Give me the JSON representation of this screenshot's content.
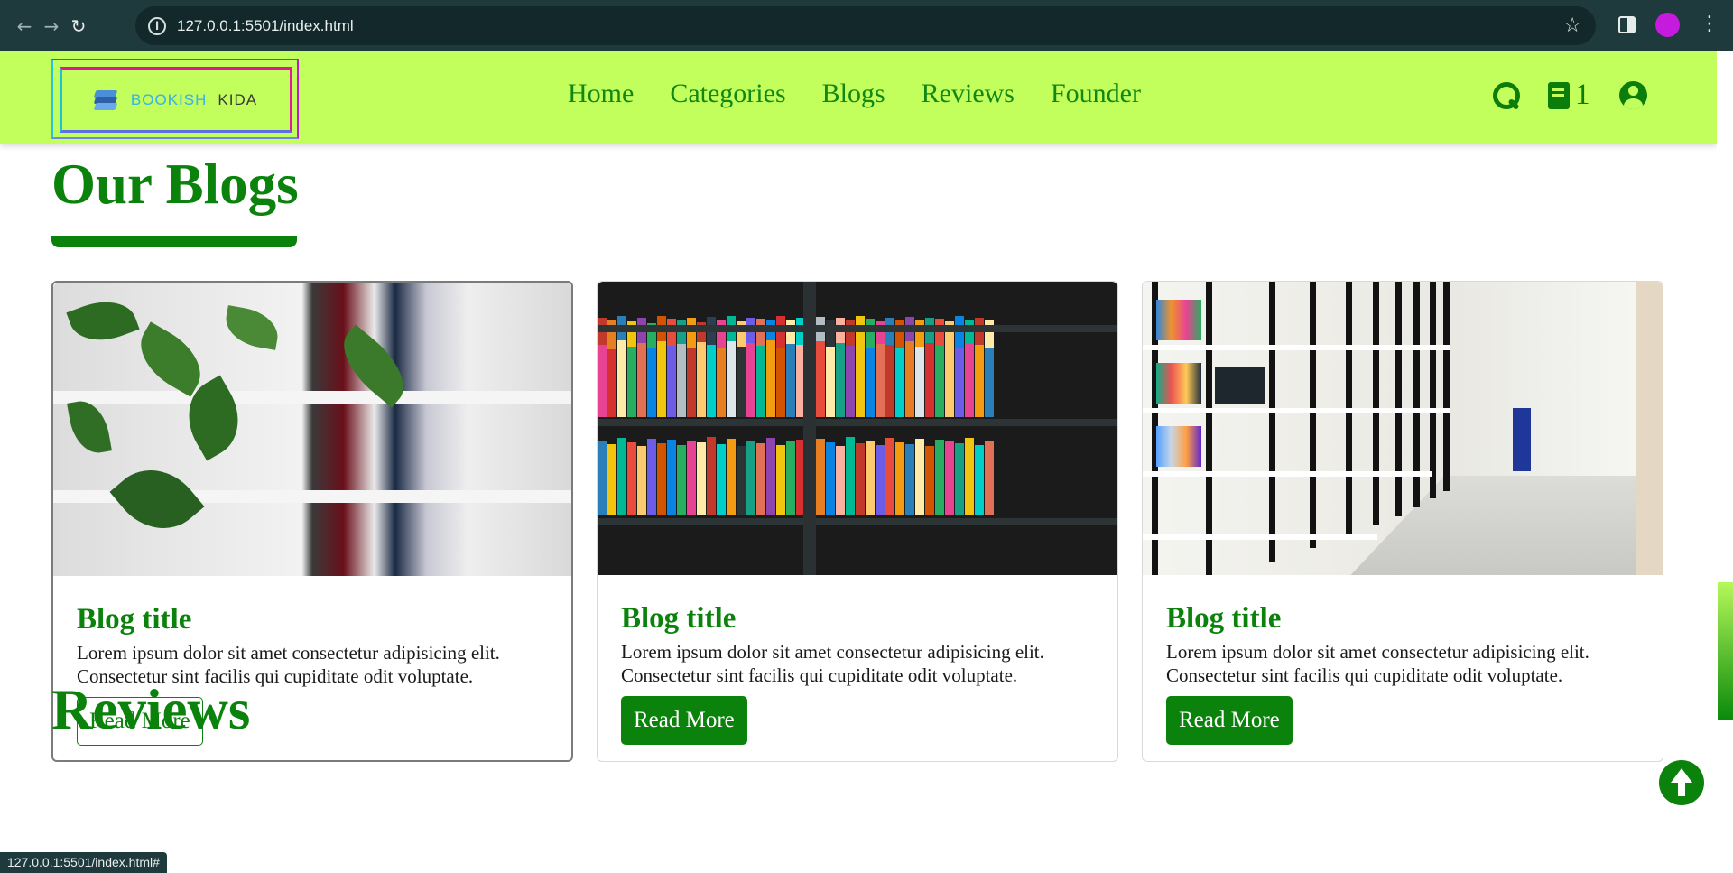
{
  "browser": {
    "url": "127.0.0.1:5501/index.html",
    "status_url": "127.0.0.1:5501/index.html#"
  },
  "header": {
    "logo": {
      "word1": "BOOKISH",
      "word2": "KIDA"
    },
    "nav": [
      "Home",
      "Categories",
      "Blogs",
      "Reviews",
      "Founder"
    ],
    "cart_count": "1",
    "icons": [
      "search-icon",
      "book-icon",
      "user-icon"
    ],
    "background": "#c3ff5c"
  },
  "blogs": {
    "title": "Our Blogs",
    "cards": [
      {
        "image": "plant and bookshelf photo",
        "title": "Blog title",
        "text": "Lorem ipsum dolor sit amet consectetur adipisicing elit. Consectetur sint facilis qui cupiditate odit voluptate.",
        "button": "Read More",
        "button_style": "outline"
      },
      {
        "image": "colorful bookshelf photo",
        "title": "Blog title",
        "text": "Lorem ipsum dolor sit amet consectetur adipisicing elit. Consectetur sint facilis qui cupiditate odit voluptate.",
        "button": "Read More",
        "button_style": "solid"
      },
      {
        "image": "library corridor photo",
        "title": "Blog title",
        "text": "Lorem ipsum dolor sit amet consectetur adipisicing elit. Consectetur sint facilis qui cupiditate odit voluptate.",
        "button": "Read More",
        "button_style": "solid"
      }
    ]
  },
  "reviews": {
    "title": "Reviews"
  },
  "colors": {
    "accent": "#0b820b",
    "header_bg": "#c3ff5c",
    "chrome_bg": "#1f3a3d"
  }
}
